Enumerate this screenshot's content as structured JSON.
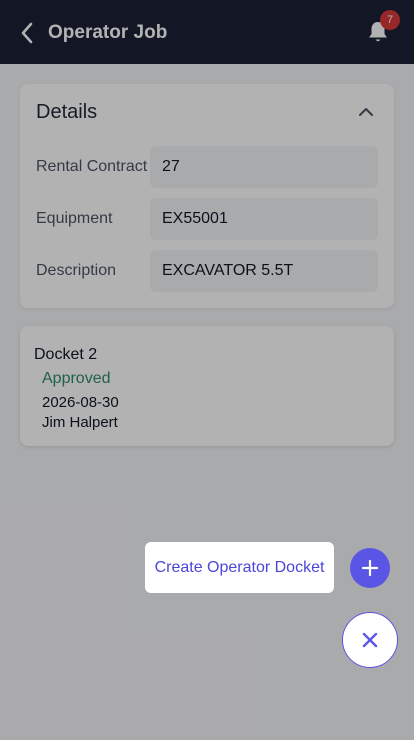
{
  "header": {
    "title": "Operator Job",
    "back_icon": "chevron-left-icon",
    "bell_icon": "bell-icon",
    "notification_count": "7"
  },
  "details": {
    "title": "Details",
    "collapse_icon": "chevron-up-icon",
    "fields": [
      {
        "label": "Rental Contract",
        "value": "27"
      },
      {
        "label": "Equipment",
        "value": "EX55001"
      },
      {
        "label": "Description",
        "value": "EXCAVATOR 5.5T"
      }
    ]
  },
  "docket": {
    "title": "Docket 2",
    "status": "Approved",
    "date": "2026-08-30",
    "operator": "Jim Halpert"
  },
  "fab": {
    "create_label": "Create Operator Docket",
    "add_icon": "plus-icon",
    "close_icon": "close-icon"
  },
  "colors": {
    "header_bg": "#1a2036",
    "accent": "#5b55e6",
    "badge": "#d93a3a",
    "status_approved": "#2e8b6b"
  }
}
